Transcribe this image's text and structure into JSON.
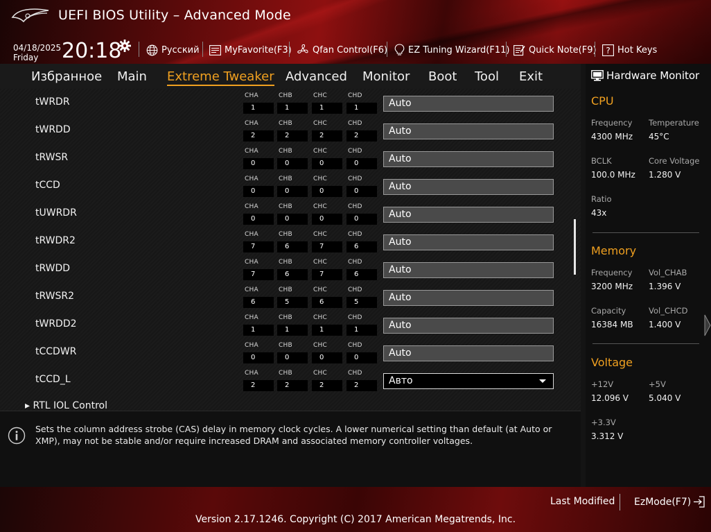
{
  "header": {
    "title": "UEFI BIOS Utility – Advanced Mode",
    "date": "04/18/2025",
    "day": "Friday",
    "time": "20:18",
    "toolbar": {
      "language": "Русский",
      "myfavorite": "MyFavorite(F3)",
      "qfan": "Qfan Control(F6)",
      "ez_tuning": "EZ Tuning Wizard(F11)",
      "quick_note": "Quick Note(F9)",
      "hot_keys": "Hot Keys"
    }
  },
  "nav": {
    "tabs": [
      {
        "label": "Избранное"
      },
      {
        "label": "Main"
      },
      {
        "label": "Extreme Tweaker"
      },
      {
        "label": "Advanced"
      },
      {
        "label": "Monitor"
      },
      {
        "label": "Boot"
      },
      {
        "label": "Tool"
      },
      {
        "label": "Exit"
      }
    ],
    "active": "Extreme Tweaker"
  },
  "channel_names": [
    "CHA",
    "CHB",
    "CHC",
    "CHD"
  ],
  "rows": [
    {
      "label": "tWRDR",
      "channels": [
        "1",
        "1",
        "1",
        "1"
      ],
      "value": "Auto"
    },
    {
      "label": "tWRDD",
      "channels": [
        "2",
        "2",
        "2",
        "2"
      ],
      "value": "Auto"
    },
    {
      "label": "tRWSR",
      "channels": [
        "0",
        "0",
        "0",
        "0"
      ],
      "value": "Auto"
    },
    {
      "label": "tCCD",
      "channels": [
        "0",
        "0",
        "0",
        "0"
      ],
      "value": "Auto"
    },
    {
      "label": "tUWRDR",
      "channels": [
        "0",
        "0",
        "0",
        "0"
      ],
      "value": "Auto"
    },
    {
      "label": "tRWDR2",
      "channels": [
        "7",
        "6",
        "7",
        "6"
      ],
      "value": "Auto"
    },
    {
      "label": "tRWDD",
      "channels": [
        "7",
        "6",
        "7",
        "6"
      ],
      "value": "Auto"
    },
    {
      "label": "tRWSR2",
      "channels": [
        "6",
        "5",
        "6",
        "5"
      ],
      "value": "Auto"
    },
    {
      "label": "tWRDD2",
      "channels": [
        "1",
        "1",
        "1",
        "1"
      ],
      "value": "Auto"
    },
    {
      "label": "tCCDWR",
      "channels": [
        "0",
        "0",
        "0",
        "0"
      ],
      "value": "Auto"
    },
    {
      "label": "tCCD_L",
      "channels": [
        "2",
        "2",
        "2",
        "2"
      ],
      "value": "Авто"
    }
  ],
  "submenu": "RTL IOL Control",
  "help_text": "Sets the column address strobe (CAS) delay in memory clock cycles. A lower numerical setting than default (at Auto or XMP), may not be stable and/or require increased DRAM and associated memory controller voltages.",
  "hw_monitor": {
    "title": "Hardware Monitor",
    "cpu": {
      "title": "CPU",
      "frequency_label": "Frequency",
      "frequency": "4300 MHz",
      "temperature_label": "Temperature",
      "temperature": "45°C",
      "bclk_label": "BCLK",
      "bclk": "100.0 MHz",
      "core_voltage_label": "Core Voltage",
      "core_voltage": "1.280 V",
      "ratio_label": "Ratio",
      "ratio": "43x"
    },
    "memory": {
      "title": "Memory",
      "frequency_label": "Frequency",
      "frequency": "3200 MHz",
      "vol_chab_label": "Vol_CHAB",
      "vol_chab": "1.396 V",
      "capacity_label": "Capacity",
      "capacity": "16384 MB",
      "vol_chcd_label": "Vol_CHCD",
      "vol_chcd": "1.400 V"
    },
    "voltage": {
      "title": "Voltage",
      "v12_label": "+12V",
      "v12": "12.096 V",
      "v5_label": "+5V",
      "v5": "5.040 V",
      "v33_label": "+3.3V",
      "v33": "3.312 V"
    }
  },
  "footer": {
    "last_modified": "Last Modified",
    "ezmode": "EzMode(F7)",
    "version": "Version 2.17.1246. Copyright (C) 2017 American Megatrends, Inc."
  },
  "colors": {
    "accent": "#f0a020",
    "header_red": "#8e1010",
    "panel": "#0f0f0f"
  }
}
